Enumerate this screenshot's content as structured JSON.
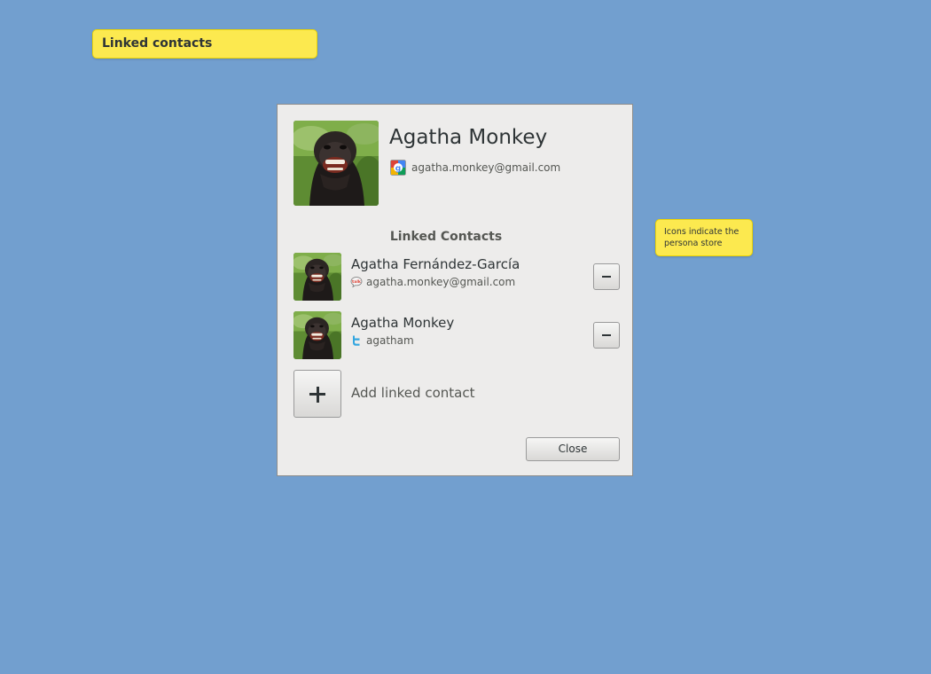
{
  "annotations": {
    "title": "Linked contacts",
    "note": "Icons indicate the persona store"
  },
  "contact": {
    "name": "Agatha Monkey",
    "email": "agatha.monkey@gmail.com",
    "store_icon": "google-icon"
  },
  "linked": {
    "section_title": "Linked Contacts",
    "items": [
      {
        "name": "Agatha Fernández-García",
        "handle": "agatha.monkey@gmail.com",
        "store_icon": "google-talk-icon",
        "remove_label": "−"
      },
      {
        "name": "Agatha Monkey",
        "handle": "agatham",
        "store_icon": "twitter-icon",
        "remove_label": "−"
      }
    ],
    "add_label": "Add linked contact"
  },
  "dialog": {
    "close_label": "Close"
  },
  "colors": {
    "background": "#729fcf",
    "sticky": "#fce94f",
    "dialog": "#edeceb"
  }
}
